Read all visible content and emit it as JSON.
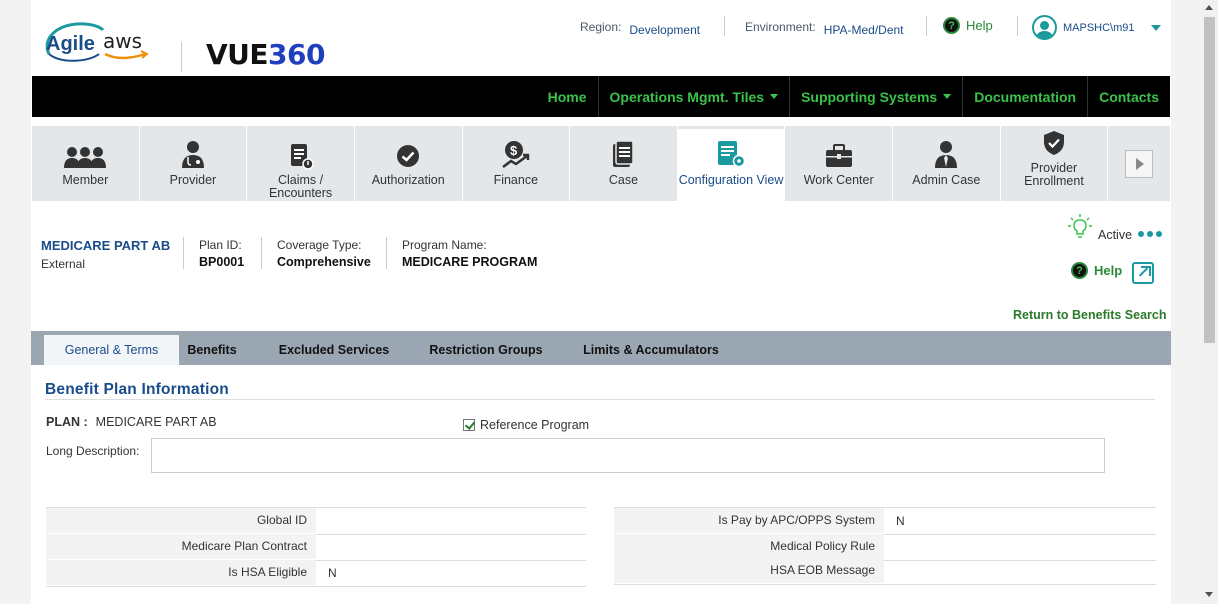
{
  "header": {
    "logo_agile": "Agile",
    "logo_aws": "aws",
    "logo_vue_a": "VUE",
    "logo_vue_b": "360",
    "region_label": "Region:",
    "region_value": "Development",
    "environment_label": "Environment:",
    "environment_value": "HPA-Med/Dent",
    "help_label": "Help",
    "username": "MAPSHC\\m91"
  },
  "nav": {
    "items": [
      {
        "label": "Home",
        "dropdown": false
      },
      {
        "label": "Operations Mgmt. Tiles",
        "dropdown": true
      },
      {
        "label": "Supporting Systems",
        "dropdown": true
      },
      {
        "label": "Documentation",
        "dropdown": false
      },
      {
        "label": "Contacts",
        "dropdown": false
      }
    ]
  },
  "tiles": [
    {
      "label": "Member",
      "icon": "members-icon"
    },
    {
      "label": "Provider",
      "icon": "doctor-icon"
    },
    {
      "label": "Claims / Encounters",
      "icon": "claims-icon"
    },
    {
      "label": "Authorization",
      "icon": "checkmark-circle-icon"
    },
    {
      "label": "Finance",
      "icon": "dollar-growth-icon"
    },
    {
      "label": "Case",
      "icon": "clipboard-icon"
    },
    {
      "label": "Configuration View",
      "icon": "config-document-icon",
      "active": true
    },
    {
      "label": "Work Center",
      "icon": "briefcase-icon"
    },
    {
      "label": "Admin Case",
      "icon": "admin-person-icon"
    },
    {
      "label": "Provider Enrollment",
      "icon": "shield-check-icon"
    }
  ],
  "plan_summary": {
    "plan_name": "MEDICARE PART AB",
    "plan_type": "External",
    "plan_id_label": "Plan ID:",
    "plan_id_value": "BP0001",
    "coverage_label": "Coverage Type:",
    "coverage_value": "Comprehensive",
    "program_label": "Program Name:",
    "program_value": "MEDICARE PROGRAM",
    "status": "Active",
    "help_label": "Help",
    "return_link": "Return to Benefits Search"
  },
  "tabs": [
    {
      "label": "General & Terms",
      "active": true
    },
    {
      "label": "Benefits"
    },
    {
      "label": "Excluded Services"
    },
    {
      "label": "Restriction Groups"
    },
    {
      "label": "Limits & Accumulators"
    }
  ],
  "content": {
    "section_title": "Benefit Plan Information",
    "plan_label": "PLAN :",
    "plan_value": "MEDICARE PART AB",
    "reference_program_label": "Reference Program",
    "reference_program_checked": true,
    "long_description_label": "Long Description:",
    "long_description_value": "",
    "left_fields": [
      {
        "label": "Global ID",
        "value": ""
      },
      {
        "label": "Medicare Plan Contract",
        "value": ""
      },
      {
        "label": "Is HSA Eligible",
        "value": "N"
      }
    ],
    "right_fields": [
      {
        "label": "Is Pay by APC/OPPS System",
        "value": "N"
      },
      {
        "label": "Medical Policy Rule",
        "value": ""
      },
      {
        "label": "HSA EOB Message",
        "value": ""
      }
    ]
  },
  "colors": {
    "accent_green": "#3ac24a",
    "link_blue": "#1a4c8a",
    "teal": "#1a9aa0",
    "tab_bar": "#9aa6b2"
  }
}
